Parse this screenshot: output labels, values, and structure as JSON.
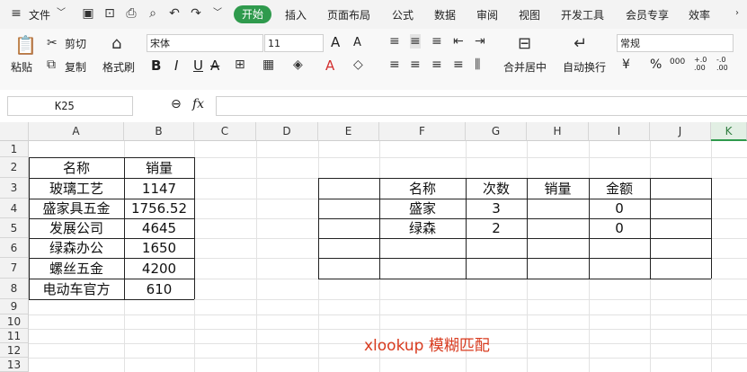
{
  "menubar": {
    "file_label": "文件",
    "tabs": [
      "开始",
      "插入",
      "页面布局",
      "公式",
      "数据",
      "审阅",
      "视图",
      "开发工具",
      "会员专享",
      "效率"
    ],
    "active_tab_color": "#2f9a4d"
  },
  "ribbon": {
    "paste_label": "粘贴",
    "cut_label": "剪切",
    "copy_label": "复制",
    "format_painter_label": "格式刷",
    "font_name": "宋体",
    "font_size": "11",
    "merge_label": "合并居中",
    "wrap_label": "自动换行",
    "number_format": "常规",
    "currency_symbol": "¥",
    "percent_symbol": "%",
    "bold": "B",
    "italic": "I",
    "underline": "U",
    "font_grow": "A",
    "font_shrink": "A"
  },
  "formula_bar": {
    "cell_ref": "K25",
    "fx_label": "fx",
    "formula": ""
  },
  "columns": [
    "A",
    "B",
    "C",
    "D",
    "E",
    "F",
    "G",
    "H",
    "I",
    "J",
    "K"
  ],
  "rows": [
    "1",
    "2",
    "3",
    "4",
    "5",
    "6",
    "7",
    "8",
    "9",
    "10",
    "11",
    "12",
    "13"
  ],
  "table1": {
    "headers": [
      "名称",
      "销量"
    ],
    "rows": [
      [
        "玻璃工艺",
        "1147"
      ],
      [
        "盛家具五金",
        "1756.52"
      ],
      [
        "发展公司",
        "4645"
      ],
      [
        "绿森办公",
        "1650"
      ],
      [
        "螺丝五金",
        "4200"
      ],
      [
        "电动车官方",
        "610"
      ]
    ]
  },
  "table2": {
    "headers": [
      "名称",
      "次数",
      "销量",
      "金额"
    ],
    "rows": [
      [
        "盛家",
        "3",
        "",
        "0"
      ],
      [
        "绿森",
        "2",
        "",
        "0"
      ]
    ]
  },
  "annotation": "xlookup 模糊匹配",
  "annotation_color": "#d83b1f"
}
